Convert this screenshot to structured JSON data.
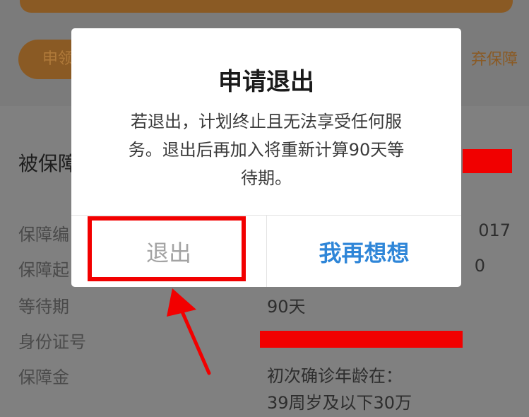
{
  "background": {
    "pill_label": "申领",
    "side_link": "弃保障",
    "section_heading": "被保障",
    "rows": [
      {
        "label": "保障编",
        "value": "017"
      },
      {
        "label": "保障起",
        "value": "0"
      },
      {
        "label": "等待期",
        "value": "90天"
      },
      {
        "label": "身份证号",
        "value": ""
      },
      {
        "label": "保障金",
        "value_line1": "初次确诊年龄在：",
        "value_line2": "39周岁及以下30万"
      }
    ]
  },
  "dialog": {
    "title": "申请退出",
    "message_lines": [
      "若退出，计划终止且无法享受任何服",
      "务。退出后再加入将重新计算90天等",
      "待期。"
    ],
    "exit_label": "退出",
    "cancel_label": "我再想想"
  },
  "annotations": {
    "highlight_color": "#f20000",
    "redaction_color": "#f10000"
  }
}
